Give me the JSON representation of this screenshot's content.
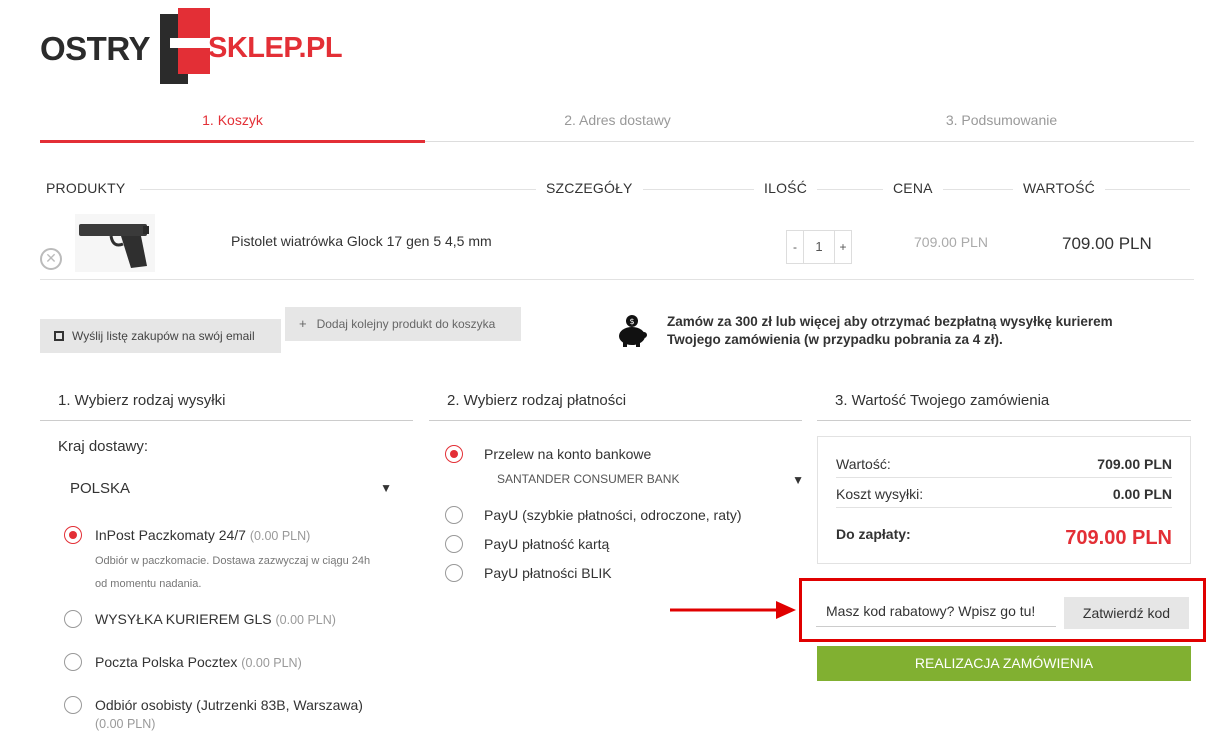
{
  "logo": {
    "left_text": "OSTRY",
    "right_text": "SKLEP.PL"
  },
  "steps": [
    {
      "label": "1. Koszyk"
    },
    {
      "label": "2. Adres dostawy"
    },
    {
      "label": "3. Podsumowanie"
    }
  ],
  "table": {
    "headers": [
      "PRODUKTY",
      "SZCZEGÓŁY",
      "ILOŚĆ",
      "CENA",
      "WARTOŚĆ"
    ],
    "rows": [
      {
        "name": "Pistolet wiatrówka Glock 17 gen 5 4,5 mm",
        "qty_minus": "-",
        "qty": "1",
        "qty_plus": "+",
        "price": "709.00 PLN",
        "value": "709.00 PLN"
      }
    ]
  },
  "actions": {
    "send_list": "Wyślij listę zakupów na swój email",
    "add_product": "Dodaj kolejny produkt do koszyka"
  },
  "promo": {
    "line1": "Zamów za 300 zł lub więcej aby otrzymać bezpłatną wysyłkę kurierem",
    "line2": "Twojego zamówienia (w przypadku pobrania za 4 zł)."
  },
  "shipping": {
    "title": "1. Wybierz rodzaj wysyłki",
    "country_label": "Kraj dostawy:",
    "country_value": "POLSKA",
    "options": [
      {
        "label": "InPost Paczkomaty 24/7",
        "price": "(0.00 PLN)",
        "desc1": "Odbiór w paczkomacie. Dostawa zazwyczaj w ciągu 24h",
        "desc2": "od momentu nadania.",
        "selected": true
      },
      {
        "label": "WYSYŁKA KURIEREM GLS",
        "price": "(0.00 PLN)",
        "selected": false
      },
      {
        "label": "Poczta Polska Pocztex",
        "price": "(0.00 PLN)",
        "selected": false
      },
      {
        "label": "Odbiór osobisty (Jutrzenki 83B, Warszawa)",
        "price": "(0.00 PLN)",
        "selected": false
      }
    ]
  },
  "payment": {
    "title": "2. Wybierz rodzaj płatności",
    "options": [
      {
        "label": "Przelew na konto bankowe",
        "sub": "SANTANDER CONSUMER BANK",
        "selected": true
      },
      {
        "label": "PayU (szybkie płatności, odroczone, raty)",
        "selected": false
      },
      {
        "label": "PayU płatność kartą",
        "selected": false
      },
      {
        "label": "PayU płatności BLIK",
        "selected": false
      }
    ]
  },
  "summary": {
    "title": "3. Wartość Twojego zamówienia",
    "value_label": "Wartość:",
    "value": "709.00 PLN",
    "shipping_label": "Koszt wysyłki:",
    "shipping": "0.00 PLN",
    "total_label": "Do zapłaty:",
    "total": "709.00 PLN"
  },
  "coupon": {
    "placeholder": "Masz kod rabatowy? Wpisz go tu!",
    "button": "Zatwierdź kod"
  },
  "order_button": "REALIZACJA ZAMÓWIENIA",
  "colors": {
    "accent": "#e32f36",
    "order": "#81b031",
    "highlight": "#e00000"
  }
}
